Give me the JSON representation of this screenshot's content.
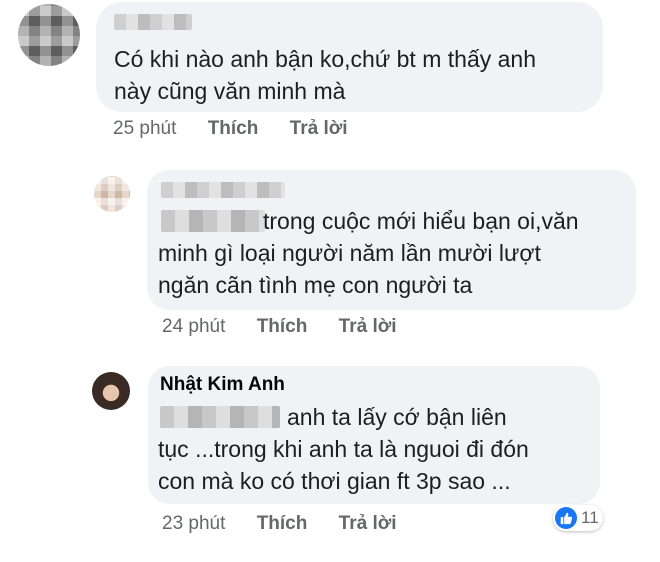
{
  "comments": [
    {
      "author": "",
      "text_lines": [
        "Có khi nào anh bận ko,chứ bt m thấy anh",
        "này cũng văn minh mà"
      ],
      "time": "25 phút",
      "like_label": "Thích",
      "reply_label": "Trả lời"
    },
    {
      "author": "",
      "text_lines": [
        "trong cuộc mới hiểu bạn oi,văn",
        "minh gì loại người năm lần mười lượt",
        "ngăn cãn tình mẹ con người ta"
      ],
      "time": "24 phút",
      "like_label": "Thích",
      "reply_label": "Trả lời"
    },
    {
      "author": "Nhật Kim Anh",
      "text_lines": [
        "anh ta lấy cớ bận liên",
        "tục ...trong khi anh ta là nguoi đi đón",
        "con mà ko có thơi gian ft 3p sao ..."
      ],
      "time": "23 phút",
      "like_label": "Thích",
      "reply_label": "Trả lời",
      "reaction": {
        "icon": "like-icon",
        "count": "11",
        "color": "#1877f2"
      }
    }
  ]
}
